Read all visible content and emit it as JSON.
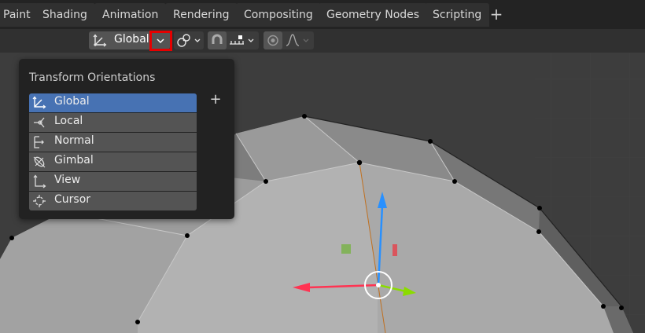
{
  "tabs": [
    "Paint",
    "Shading",
    "Animation",
    "Rendering",
    "Compositing",
    "Geometry Nodes",
    "Scripting"
  ],
  "tab_add_label": "+",
  "header": {
    "orientation_value": "Global",
    "orientation_icon": "transform-orientation-global-icon",
    "pivot_icon": "pivot-point-icon",
    "snap_icon": "snap-magnet-icon",
    "snap_target_icon": "snap-increment-icon",
    "proportional_icon": "proportional-editing-icon",
    "falloff_icon": "falloff-curve-icon"
  },
  "popup": {
    "title": "Transform Orientations",
    "add_label": "+",
    "items": [
      {
        "label": "Global",
        "icon": "global-axes-icon",
        "selected": true
      },
      {
        "label": "Local",
        "icon": "local-axes-icon",
        "selected": false
      },
      {
        "label": "Normal",
        "icon": "normal-icon",
        "selected": false
      },
      {
        "label": "Gimbal",
        "icon": "gimbal-icon",
        "selected": false
      },
      {
        "label": "View",
        "icon": "view-axes-icon",
        "selected": false
      },
      {
        "label": "Cursor",
        "icon": "cursor-icon",
        "selected": false
      }
    ]
  },
  "colors": {
    "selected": "#4772b3",
    "highlight_box": "#e60000",
    "gizmo_x": "#ff3352",
    "gizmo_y": "#8bdc00",
    "gizmo_z": "#2890ff"
  }
}
